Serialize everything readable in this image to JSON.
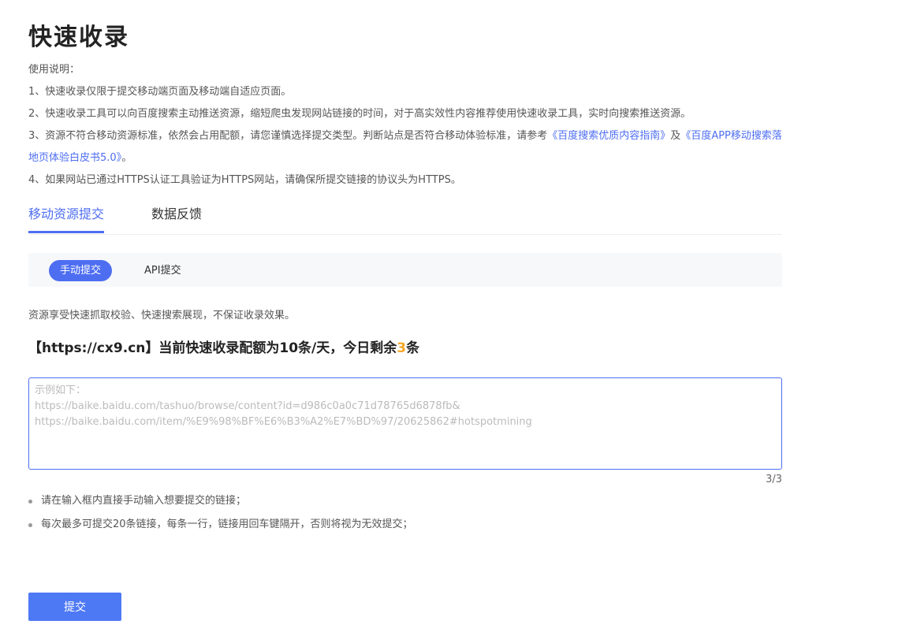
{
  "page": {
    "title": "快速收录"
  },
  "instructions": {
    "heading": "使用说明：",
    "item1": "1、快速收录仅限于提交移动端页面及移动端自适应页面。",
    "item2": "2、快速收录工具可以向百度搜索主动推送资源，缩短爬虫发现网站链接的时间，对于高实效性内容推荐使用快速收录工具，实时向搜索推送资源。",
    "item3_text_a": "3、资源不符合移动资源标准，依然会占用配额，请您谨慎选择提交类型。判断站点是否符合移动体验标准，请参考",
    "item3_link1": "《百度搜索优质内容指南》",
    "item3_text_b": "及",
    "item3_link2": "《百度APP移动搜索落地页体验白皮书5.0》",
    "item3_text_c": "。",
    "item4": "4、如果网站已通过HTTPS认证工具验证为HTTPS网站，请确保所提交链接的协议头为HTTPS。"
  },
  "tabs": {
    "mobile": "移动资源提交",
    "feedback": "数据反馈"
  },
  "subtabs": {
    "manual": "手动提交",
    "api": "API提交"
  },
  "note": "资源享受快速抓取校验、快速搜索展现，不保证收录效果。",
  "quota": {
    "prefix": "【https://cx9.cn】当前快速收录配额为10条/天，今日剩余",
    "remaining": "3",
    "suffix": "条"
  },
  "textarea": {
    "value": "",
    "placeholder": "示例如下：\nhttps://baike.baidu.com/tashuo/browse/content?id=d986c0a0c71d78765d6878fb&\nhttps://baike.baidu.com/item/%E9%98%BF%E6%B3%A2%E7%BD%97/20625862#hotspotmining"
  },
  "counter": "3/3",
  "tips": [
    "请在输入框内直接手动输入想要提交的链接；",
    "每次最多可提交20条链接，每条一行，链接用回车键隔开，否则将视为无效提交；"
  ],
  "submit_label": "提交",
  "colors": {
    "accent": "#4e6ef2",
    "highlight": "#f5a623",
    "button": "#4e79f5"
  }
}
